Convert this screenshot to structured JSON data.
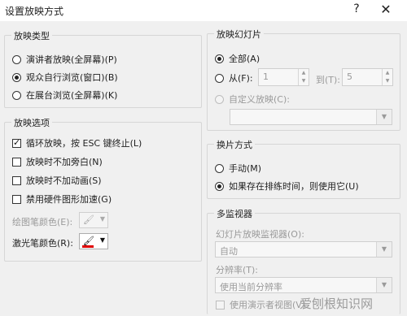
{
  "window": {
    "title": "设置放映方式",
    "help_label": "?",
    "close_label": "✕"
  },
  "show_type": {
    "title": "放映类型",
    "options": [
      {
        "label": "演讲者放映(全屏幕)(P)",
        "selected": false
      },
      {
        "label": "观众自行浏览(窗口)(B)",
        "selected": true
      },
      {
        "label": "在展台浏览(全屏幕)(K)",
        "selected": false
      }
    ]
  },
  "show_options": {
    "title": "放映选项",
    "checks": [
      {
        "label": "循环放映，按 ESC 键终止(L)",
        "checked": true
      },
      {
        "label": "放映时不加旁白(N)",
        "checked": false
      },
      {
        "label": "放映时不加动画(S)",
        "checked": false
      },
      {
        "label": "禁用硬件图形加速(G)",
        "checked": false
      }
    ],
    "pen_color_label": "绘图笔颜色(E):",
    "laser_color_label": "激光笔颜色(R):",
    "laser_color": "#e00000"
  },
  "slides": {
    "title": "放映幻灯片",
    "all_label": "全部(A)",
    "from_label": "从(F):",
    "from_value": "1",
    "to_label": "到(T):",
    "to_value": "5",
    "custom_label": "自定义放映(C):"
  },
  "advance": {
    "title": "换片方式",
    "manual_label": "手动(M)",
    "timings_label": "如果存在排练时间，则使用它(U)"
  },
  "monitors": {
    "title": "多监视器",
    "slide_monitor_label": "幻灯片放映监视器(O):",
    "slide_monitor_value": "自动",
    "resolution_label": "分辨率(T):",
    "resolution_value": "使用当前分辨率",
    "presenter_view_label": "使用演示者视图(V)"
  },
  "watermark": "爱刨根知识网"
}
